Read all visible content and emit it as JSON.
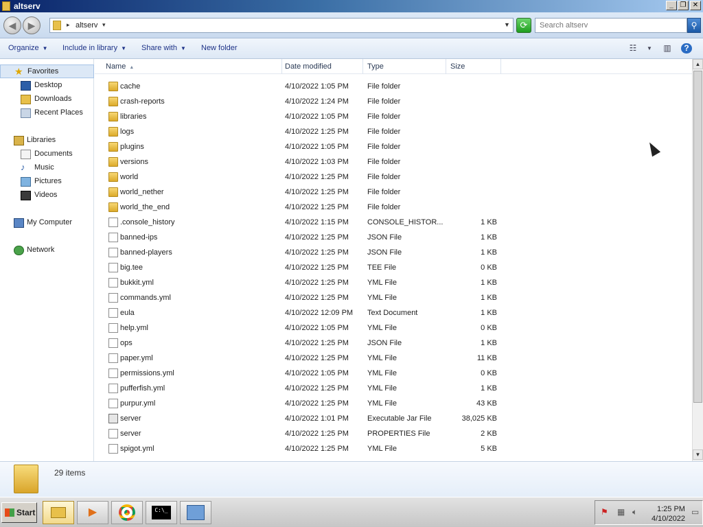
{
  "window": {
    "title": "altserv"
  },
  "address": {
    "crumb": "altserv",
    "search_placeholder": "Search altserv"
  },
  "commands": {
    "organize": "Organize",
    "include": "Include in library",
    "share": "Share with",
    "new_folder": "New folder"
  },
  "nav": {
    "favorites": "Favorites",
    "desktop": "Desktop",
    "downloads": "Downloads",
    "recent": "Recent Places",
    "libraries": "Libraries",
    "documents": "Documents",
    "music": "Music",
    "pictures": "Pictures",
    "videos": "Videos",
    "computer": "My Computer",
    "network": "Network"
  },
  "columns": {
    "name": "Name",
    "date": "Date modified",
    "type": "Type",
    "size": "Size"
  },
  "files": [
    {
      "name": "cache",
      "date": "4/10/2022 1:05 PM",
      "type": "File folder",
      "size": "",
      "kind": "folder"
    },
    {
      "name": "crash-reports",
      "date": "4/10/2022 1:24 PM",
      "type": "File folder",
      "size": "",
      "kind": "folder"
    },
    {
      "name": "libraries",
      "date": "4/10/2022 1:05 PM",
      "type": "File folder",
      "size": "",
      "kind": "folder"
    },
    {
      "name": "logs",
      "date": "4/10/2022 1:25 PM",
      "type": "File folder",
      "size": "",
      "kind": "folder"
    },
    {
      "name": "plugins",
      "date": "4/10/2022 1:05 PM",
      "type": "File folder",
      "size": "",
      "kind": "folder"
    },
    {
      "name": "versions",
      "date": "4/10/2022 1:03 PM",
      "type": "File folder",
      "size": "",
      "kind": "folder"
    },
    {
      "name": "world",
      "date": "4/10/2022 1:25 PM",
      "type": "File folder",
      "size": "",
      "kind": "folder"
    },
    {
      "name": "world_nether",
      "date": "4/10/2022 1:25 PM",
      "type": "File folder",
      "size": "",
      "kind": "folder"
    },
    {
      "name": "world_the_end",
      "date": "4/10/2022 1:25 PM",
      "type": "File folder",
      "size": "",
      "kind": "folder"
    },
    {
      "name": ".console_history",
      "date": "4/10/2022 1:15 PM",
      "type": "CONSOLE_HISTOR...",
      "size": "1 KB",
      "kind": "file"
    },
    {
      "name": "banned-ips",
      "date": "4/10/2022 1:25 PM",
      "type": "JSON File",
      "size": "1 KB",
      "kind": "file"
    },
    {
      "name": "banned-players",
      "date": "4/10/2022 1:25 PM",
      "type": "JSON File",
      "size": "1 KB",
      "kind": "file"
    },
    {
      "name": "big.tee",
      "date": "4/10/2022 1:25 PM",
      "type": "TEE File",
      "size": "0 KB",
      "kind": "file"
    },
    {
      "name": "bukkit.yml",
      "date": "4/10/2022 1:25 PM",
      "type": "YML File",
      "size": "1 KB",
      "kind": "file"
    },
    {
      "name": "commands.yml",
      "date": "4/10/2022 1:25 PM",
      "type": "YML File",
      "size": "1 KB",
      "kind": "file"
    },
    {
      "name": "eula",
      "date": "4/10/2022 12:09 PM",
      "type": "Text Document",
      "size": "1 KB",
      "kind": "file"
    },
    {
      "name": "help.yml",
      "date": "4/10/2022 1:05 PM",
      "type": "YML File",
      "size": "0 KB",
      "kind": "file"
    },
    {
      "name": "ops",
      "date": "4/10/2022 1:25 PM",
      "type": "JSON File",
      "size": "1 KB",
      "kind": "file"
    },
    {
      "name": "paper.yml",
      "date": "4/10/2022 1:25 PM",
      "type": "YML File",
      "size": "11 KB",
      "kind": "file"
    },
    {
      "name": "permissions.yml",
      "date": "4/10/2022 1:05 PM",
      "type": "YML File",
      "size": "0 KB",
      "kind": "file"
    },
    {
      "name": "pufferfish.yml",
      "date": "4/10/2022 1:25 PM",
      "type": "YML File",
      "size": "1 KB",
      "kind": "file"
    },
    {
      "name": "purpur.yml",
      "date": "4/10/2022 1:25 PM",
      "type": "YML File",
      "size": "43 KB",
      "kind": "file"
    },
    {
      "name": "server",
      "date": "4/10/2022 1:01 PM",
      "type": "Executable Jar File",
      "size": "38,025 KB",
      "kind": "jar"
    },
    {
      "name": "server",
      "date": "4/10/2022 1:25 PM",
      "type": "PROPERTIES File",
      "size": "2 KB",
      "kind": "file"
    },
    {
      "name": "spigot.yml",
      "date": "4/10/2022 1:25 PM",
      "type": "YML File",
      "size": "5 KB",
      "kind": "file"
    }
  ],
  "details": {
    "count": "29 items"
  },
  "taskbar": {
    "start": "Start",
    "time": "1:25 PM",
    "date": "4/10/2022"
  }
}
